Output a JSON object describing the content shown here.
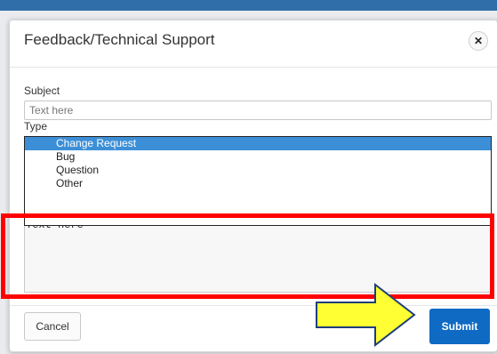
{
  "dialog": {
    "title": "Feedback/Technical Support",
    "close_glyph": "✕"
  },
  "form": {
    "subject": {
      "label": "Subject",
      "placeholder": "Text here",
      "value": ""
    },
    "type": {
      "label": "Type",
      "options": [
        "Change Request",
        "Bug",
        "Question",
        "Other"
      ],
      "selected": "Change Request"
    },
    "message": {
      "value": "Text here"
    }
  },
  "footer": {
    "cancel_label": "Cancel",
    "submit_label": "Submit"
  },
  "annotations": {
    "highlight_color": "#ff0000",
    "arrow_color": "#ffff33",
    "arrow_icon": "arrow-right-icon"
  },
  "colors": {
    "primary": "#0f6ac4",
    "selected_option": "#3c8fd7",
    "top_bar": "#2f6ea8"
  }
}
